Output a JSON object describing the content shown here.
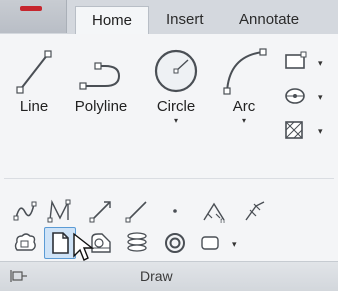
{
  "tabs": [
    {
      "label": "Home",
      "active": true
    },
    {
      "label": "Insert",
      "active": false
    },
    {
      "label": "Annotate",
      "active": false
    }
  ],
  "draw_panel": {
    "title": "Draw",
    "large_tools": [
      {
        "label": "Line",
        "icon": "line-icon",
        "has_dropdown": false
      },
      {
        "label": "Polyline",
        "icon": "polyline-icon",
        "has_dropdown": false
      },
      {
        "label": "Circle",
        "icon": "circle-icon",
        "has_dropdown": true
      },
      {
        "label": "Arc",
        "icon": "arc-icon",
        "has_dropdown": true
      }
    ],
    "small_tools_right": [
      {
        "icon": "rectangle-icon",
        "has_dropdown": true
      },
      {
        "icon": "ellipse-icon",
        "has_dropdown": true
      },
      {
        "icon": "hatch-icon",
        "has_dropdown": true
      }
    ],
    "row1_icons": [
      "spline-fit-icon",
      "spline-cv-icon",
      "ray-icon",
      "construction-line-icon",
      "point-icon",
      "divide-icon",
      "measure-icon"
    ],
    "row2_icons": [
      "revision-cloud-icon",
      "region-icon",
      "boundary-icon",
      "table-icon",
      "donut-icon",
      "wipeout-icon"
    ],
    "selected_tool": "region-icon"
  },
  "colors": {
    "tabstrip": "#d4d8de",
    "panel_bg": "#f4f5f7",
    "active_tab": "#f4f6f8",
    "selection_fill": "#cfe3f7",
    "selection_border": "#5b9bd5",
    "brand_red": "#c6262e"
  }
}
